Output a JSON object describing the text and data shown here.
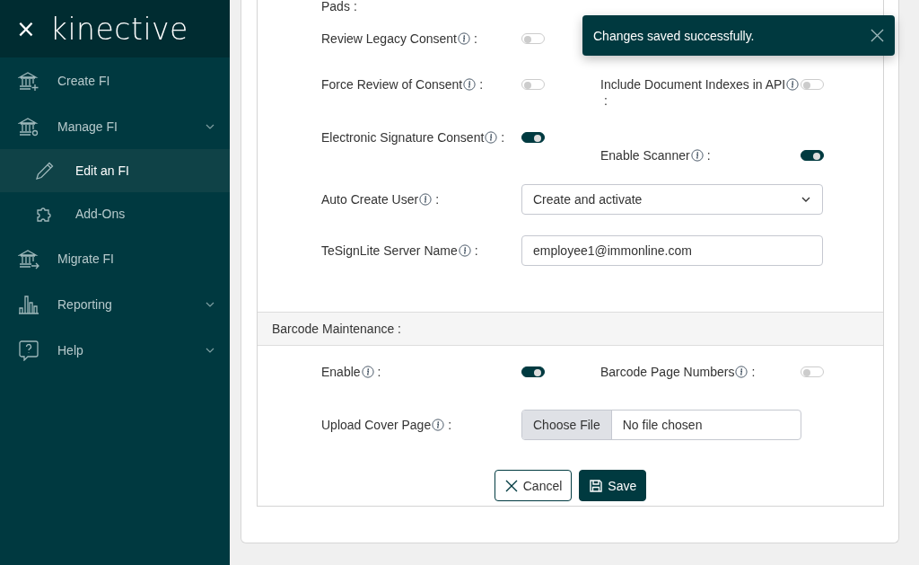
{
  "sidebar": {
    "close": "×",
    "logo": "kinective",
    "items": [
      {
        "label": "Create FI",
        "kind": "link",
        "selected": false
      },
      {
        "label": "Manage FI",
        "kind": "group",
        "selected": false,
        "children": [
          {
            "label": "Edit an FI",
            "selected": true
          },
          {
            "label": "Add-Ons",
            "selected": false
          }
        ]
      },
      {
        "label": "Migrate FI",
        "kind": "link",
        "selected": false
      },
      {
        "label": "Reporting",
        "kind": "group",
        "selected": false
      },
      {
        "label": "Help",
        "kind": "group",
        "selected": false
      }
    ]
  },
  "form": {
    "top_label": "Pads",
    "top_separator": ":",
    "rows": [
      {
        "left": {
          "kind": "toggle",
          "label": "Review Legacy Consent",
          "separator": ":",
          "on": false
        }
      },
      {
        "left": {
          "kind": "toggle",
          "label": "Force Review of Consent",
          "separator": ":",
          "on": false
        },
        "right": {
          "kind": "toggle",
          "label": "Include Document Indexes in API",
          "separator": ":",
          "on": false
        }
      },
      {
        "left": {
          "kind": "toggle",
          "label": "Electronic Signature Consent",
          "separator": ":",
          "on": true
        },
        "right": {
          "kind": "toggle",
          "label": "Enable Scanner",
          "separator": ":",
          "on": true
        }
      },
      {
        "left": {
          "kind": "select",
          "label": "Auto Create User",
          "separator": ":",
          "value": "Create and activate"
        }
      },
      {
        "left": {
          "kind": "input",
          "label": "TeSignLite Server Name",
          "separator": ":",
          "value": "employee1@immonline.com"
        }
      }
    ],
    "section_title": "Barcode Maintenance :",
    "section_rows": [
      {
        "left": {
          "kind": "toggle",
          "label": "Enable",
          "separator": ":",
          "on": true
        },
        "right": {
          "kind": "toggle",
          "label": "Barcode Page Numbers",
          "separator": ":",
          "on": false
        }
      },
      {
        "left": {
          "kind": "file",
          "label": "Upload Cover Page",
          "separator": ":",
          "button": "Choose File",
          "value": "No file chosen"
        }
      }
    ],
    "buttons": [
      {
        "label": "Cancel",
        "kind": "secondary"
      },
      {
        "label": "Save",
        "kind": "primary"
      }
    ]
  },
  "toast": {
    "message": "Changes saved successfully."
  }
}
